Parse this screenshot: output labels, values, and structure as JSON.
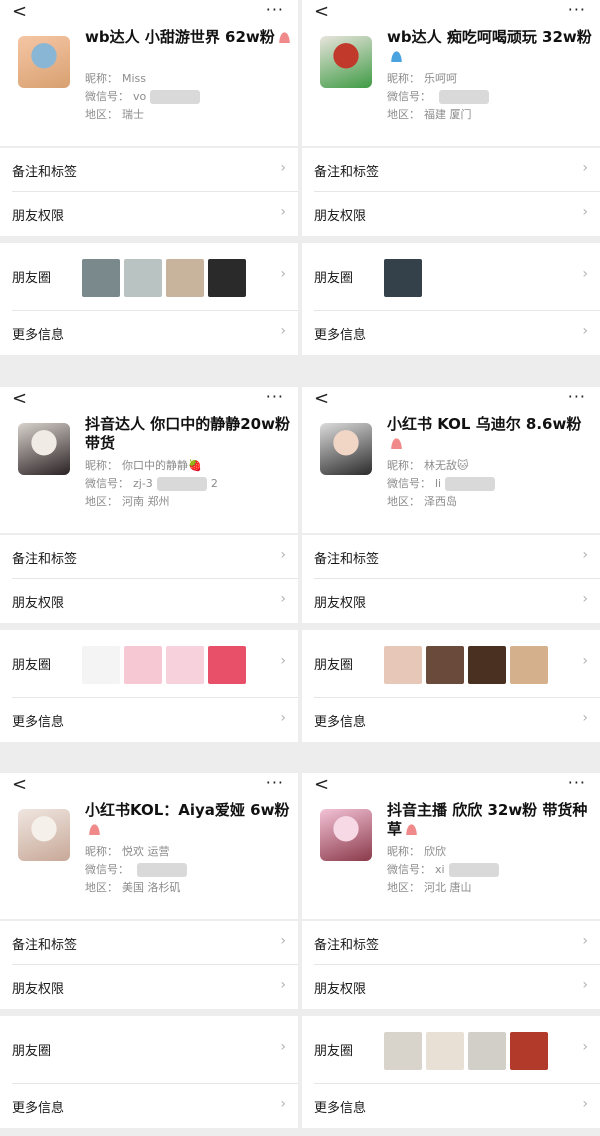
{
  "panels": [
    {
      "title": "wb达人 小甜游世界 62w粉",
      "gender": "female",
      "nickname_label": "昵称：",
      "nickname": "Miss",
      "wechat_label": "微信号：",
      "wechat": "vo",
      "region_label": "地区：",
      "region": "瑞士",
      "rows": {
        "notes": "备注和标签",
        "permissions": "朋友权限",
        "moments": "朋友圈",
        "more_info": "更多信息"
      },
      "moments_thumbs": 4,
      "avatar_colors": [
        "#f5c6a5",
        "#d8a070",
        "#8ab6d6"
      ],
      "thumb_colors": [
        "#7a8a8c",
        "#b9c4c2",
        "#c8b39c",
        "#2b2a2a"
      ],
      "nav": {
        "back": "<",
        "more": "···"
      }
    },
    {
      "title": "wb达人 痴吃呵喝顽玩 32w粉",
      "gender": "male",
      "nickname_label": "昵称：",
      "nickname": "乐呵呵",
      "wechat_label": "微信号：",
      "wechat": "",
      "region_label": "地区：",
      "region": "福建 厦门",
      "rows": {
        "notes": "备注和标签",
        "permissions": "朋友权限",
        "moments": "朋友圈",
        "more_info": "更多信息"
      },
      "moments_thumbs": 1,
      "avatar_colors": [
        "#e8e4dc",
        "#3f9b45",
        "#c0392b"
      ],
      "thumb_colors": [
        "#34414a"
      ],
      "nav": {
        "back": "<",
        "more": "···"
      }
    },
    {
      "title": "抖音达人 你口中的静静20w粉 带货",
      "gender": "",
      "nickname_label": "昵称：",
      "nickname": "你口中的静静🍓",
      "wechat_label": "微信号：",
      "wechat": "zj-3",
      "wechat_tail": "2",
      "region_label": "地区：",
      "region": "河南 郑州",
      "rows": {
        "notes": "备注和标签",
        "permissions": "朋友权限",
        "moments": "朋友圈",
        "more_info": "更多信息"
      },
      "moments_thumbs": 4,
      "avatar_colors": [
        "#d8d2cc",
        "#2a2224",
        "#f1ebe5"
      ],
      "thumb_colors": [
        "#f4f4f4",
        "#f6c8d3",
        "#f7d2dc",
        "#e8506a"
      ],
      "nav": {
        "back": "<",
        "more": "···"
      }
    },
    {
      "title": "小红书 KOL 乌迪尔 8.6w粉",
      "gender": "female",
      "nickname_label": "昵称：",
      "nickname": "林无敌🐱",
      "wechat_label": "微信号：",
      "wechat": "li",
      "region_label": "地区：",
      "region": "泽西岛",
      "rows": {
        "notes": "备注和标签",
        "permissions": "朋友权限",
        "moments": "朋友圈",
        "more_info": "更多信息"
      },
      "moments_thumbs": 4,
      "avatar_colors": [
        "#dcdcdc",
        "#2b2b2b",
        "#f1d6c6"
      ],
      "thumb_colors": [
        "#e6c7b8",
        "#6a4a3a",
        "#4a3020",
        "#d4b08c"
      ],
      "nav": {
        "back": "<",
        "more": "···"
      }
    },
    {
      "title": "小红书KOL：Aiya爱娅 6w粉",
      "gender": "female",
      "nickname_label": "昵称：",
      "nickname": "悦欢 运营",
      "wechat_label": "微信号：",
      "wechat": "",
      "region_label": "地区：",
      "region": "美国 洛杉矶",
      "rows": {
        "notes": "备注和标签",
        "permissions": "朋友权限",
        "moments": "朋友圈",
        "more_info": "更多信息"
      },
      "moments_thumbs": 0,
      "avatar_colors": [
        "#efe6e0",
        "#c8a898",
        "#f5f0ea"
      ],
      "thumb_colors": [],
      "nav": {
        "back": "<",
        "more": "···"
      }
    },
    {
      "title": "抖音主播 欣欣 32w粉 带货种草",
      "gender": "female",
      "nickname_label": "昵称：",
      "nickname": "欣欣",
      "wechat_label": "微信号：",
      "wechat": "xi",
      "region_label": "地区：",
      "region": "河北 唐山",
      "rows": {
        "notes": "备注和标签",
        "permissions": "朋友权限",
        "moments": "朋友圈",
        "more_info": "更多信息"
      },
      "moments_thumbs": 4,
      "avatar_colors": [
        "#f3c2d6",
        "#8a3a4a",
        "#f6d9e4"
      ],
      "thumb_colors": [
        "#d8d4cc",
        "#e8e0d4",
        "#d2cfc9",
        "#b23a2a"
      ],
      "nav": {
        "back": "<",
        "more": "···"
      }
    }
  ]
}
